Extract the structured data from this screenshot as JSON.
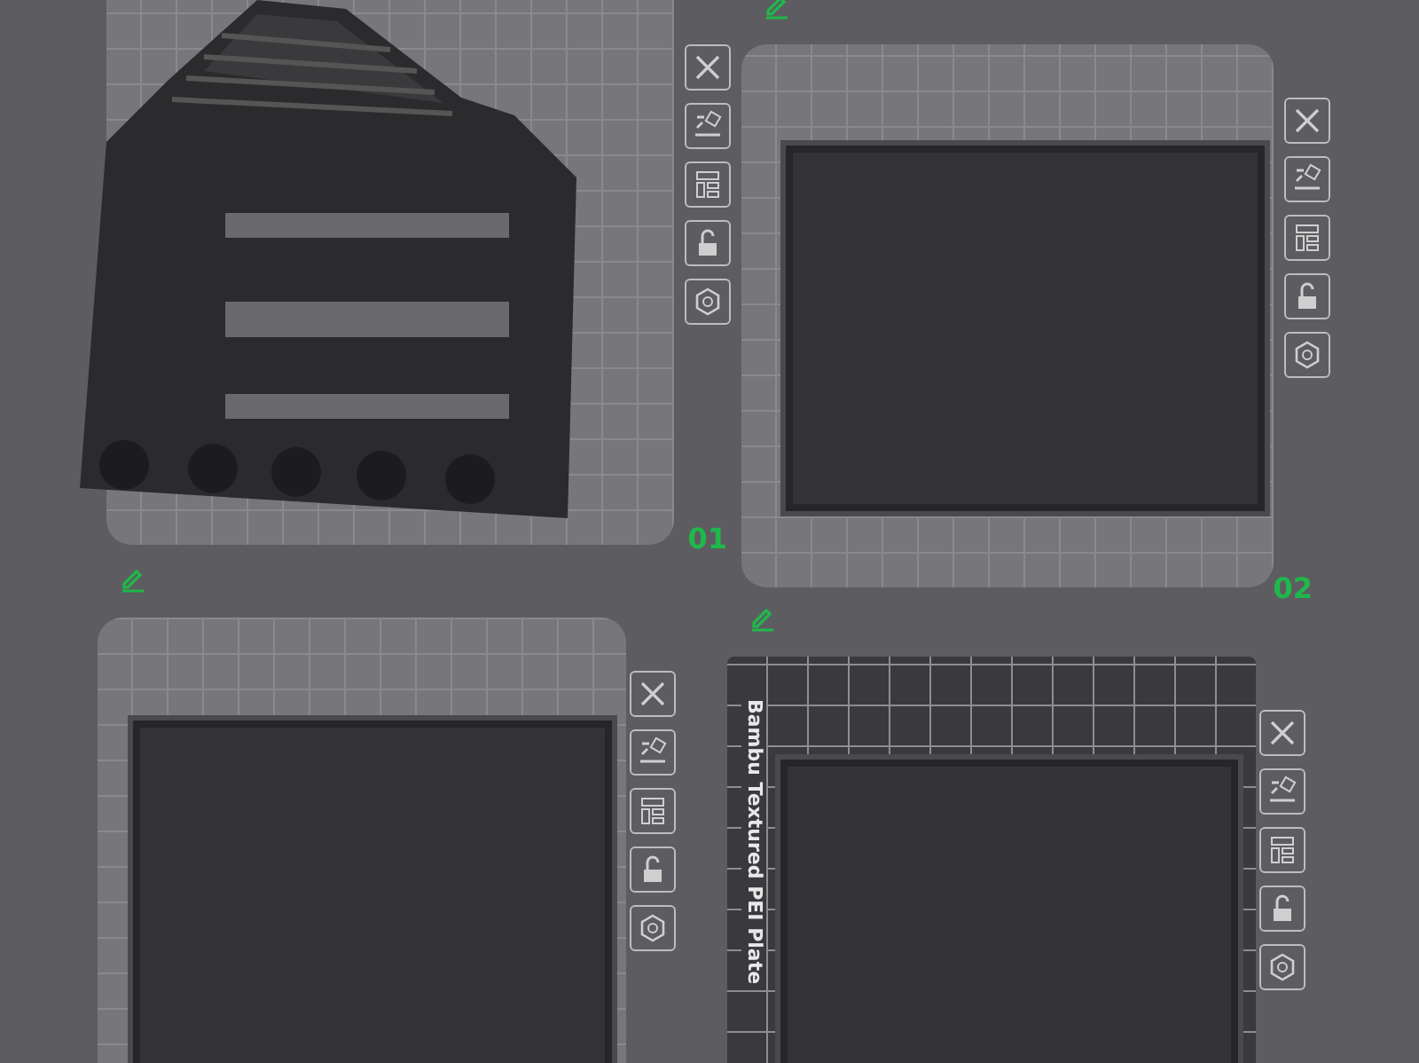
{
  "plates": [
    {
      "label": "01",
      "locked": false,
      "textured": false,
      "kind": "shelf"
    },
    {
      "label": "02",
      "locked": false,
      "textured": false,
      "kind": "tray"
    },
    {
      "locked": false,
      "textured": false,
      "kind": "tray"
    },
    {
      "locked": false,
      "textured": true,
      "plate_name": "Bambu Textured PEI Plate",
      "kind": "tray"
    }
  ]
}
